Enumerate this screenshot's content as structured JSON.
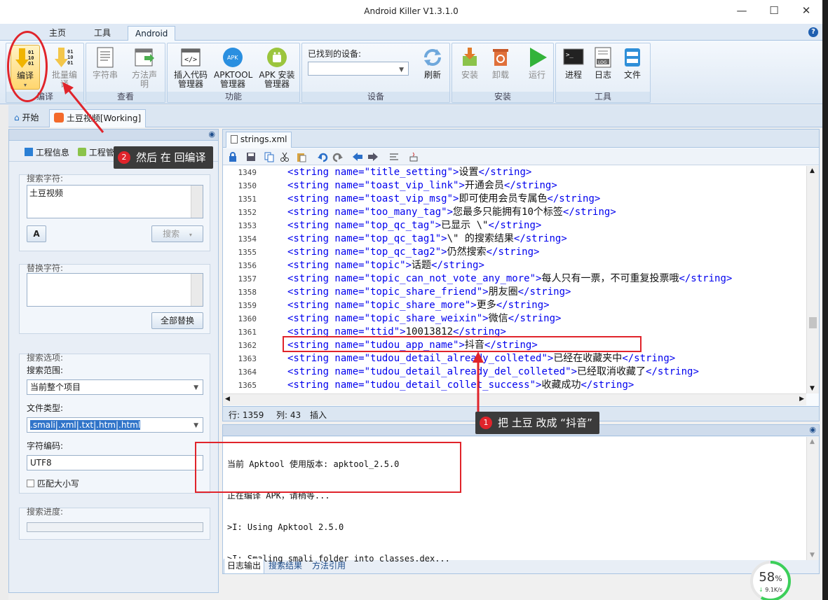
{
  "window": {
    "title": "Android Killer V1.3.1.0"
  },
  "ribbon_tabs": [
    "主页",
    "工具",
    "Android"
  ],
  "ribbon": {
    "compile": "编译",
    "batch_compile_1": "批量编",
    "batch_compile_2": "译",
    "compile_group": "编译",
    "string_view": "字符串",
    "method_decl_1": "方法声",
    "method_decl_2": "明",
    "view_group": "查看",
    "insert_code_1": "插入代码",
    "insert_code_2": "管理器",
    "apktool_1": "APKTOOL",
    "apktool_2": "管理器",
    "apk_install_1": "APK 安装",
    "apk_install_2": "管理器",
    "function_group": "功能",
    "devices_found": "已找到的设备:",
    "refresh": "刷新",
    "device_group": "设备",
    "install": "安装",
    "uninstall": "卸载",
    "run": "运行",
    "install_group": "安装",
    "process": "进程",
    "log": "日志",
    "file": "文件",
    "tools_group": "工具",
    "apk_badge": "APK",
    "log_badge": "LOG"
  },
  "doc_tabs": {
    "start": "开始",
    "project": "土豆视频[Working]"
  },
  "left": {
    "subtab_info": "工程信息",
    "subtab_manager": "工程管理器",
    "search_chars": "搜索字符:",
    "search_value": "土豆视频",
    "search_btn": "搜索",
    "replace_chars": "替换字符:",
    "replace_all": "全部替换",
    "search_options": "搜索选项:",
    "search_scope": "搜索范围:",
    "scope_value": "当前整个项目",
    "file_type": "文件类型:",
    "file_type_value": ".smali|.xml|.txt|.htm|.html",
    "encoding": "字符编码:",
    "encoding_value": "UTF8",
    "match_case": "匹配大小写",
    "search_progress": "搜索进度:"
  },
  "editor": {
    "tab": "strings.xml",
    "lines": [
      {
        "n": "1349",
        "name": "title_setting",
        "val": "设置"
      },
      {
        "n": "1350",
        "name": "toast_vip_link",
        "val": "开通会员"
      },
      {
        "n": "1351",
        "name": "toast_vip_msg",
        "val": "即可使用会员专属色"
      },
      {
        "n": "1352",
        "name": "too_many_tag",
        "val": "您最多只能拥有10个标签"
      },
      {
        "n": "1353",
        "name": "top_qc_tag",
        "val": "已显示 \\\""
      },
      {
        "n": "1354",
        "name": "top_qc_tag1",
        "val": "\\\" 的搜索结果"
      },
      {
        "n": "1355",
        "name": "top_qc_tag2",
        "val": "仍然搜索"
      },
      {
        "n": "1356",
        "name": "topic",
        "val": "话题"
      },
      {
        "n": "1357",
        "name": "topic_can_not_vote_any_more",
        "val": "每人只有一票，不可重复投票哦"
      },
      {
        "n": "1358",
        "name": "topic_share_friend",
        "val": "朋友圈"
      },
      {
        "n": "1359",
        "name": "topic_share_more",
        "val": "更多"
      },
      {
        "n": "1360",
        "name": "topic_share_weixin",
        "val": "微信"
      },
      {
        "n": "1361",
        "name": "ttid",
        "val": "10013812"
      },
      {
        "n": "1362",
        "name": "tudou_app_name",
        "val": "抖音"
      },
      {
        "n": "1363",
        "name": "tudou_detail_already_colleted",
        "val": "已经在收藏夹中"
      },
      {
        "n": "1364",
        "name": "tudou_detail_already_del_colleted",
        "val": "已经取消收藏了"
      },
      {
        "n": "1365",
        "name": "tudou_detail_collet_success",
        "val": "收藏成功"
      }
    ],
    "status_line": "行: 1359",
    "status_col": "列: 43",
    "status_mode": "插入"
  },
  "log": {
    "lines": [
      "当前 Apktool 使用版本: apktool_2.5.0",
      "正在编译 APK，请稍等...",
      ">I: Using Apktool 2.5.0",
      ">I: Smaling smali folder into classes.dex..."
    ],
    "tab_log": "日志输出",
    "tab_search": "搜索结果",
    "tab_method": "方法引用"
  },
  "annotations": {
    "callout1_num": "1",
    "callout1_text": "把 土豆 改成 “抖音”",
    "callout2_num": "2",
    "callout2_text": "然后 在 回编译"
  },
  "net": {
    "percent": "58",
    "unit": "%",
    "speed": "9.1K/s"
  },
  "colors": {
    "annotation_red": "#e0242b",
    "ribbon_blue": "#dfe9f5",
    "code_blue": "#0000ee"
  }
}
